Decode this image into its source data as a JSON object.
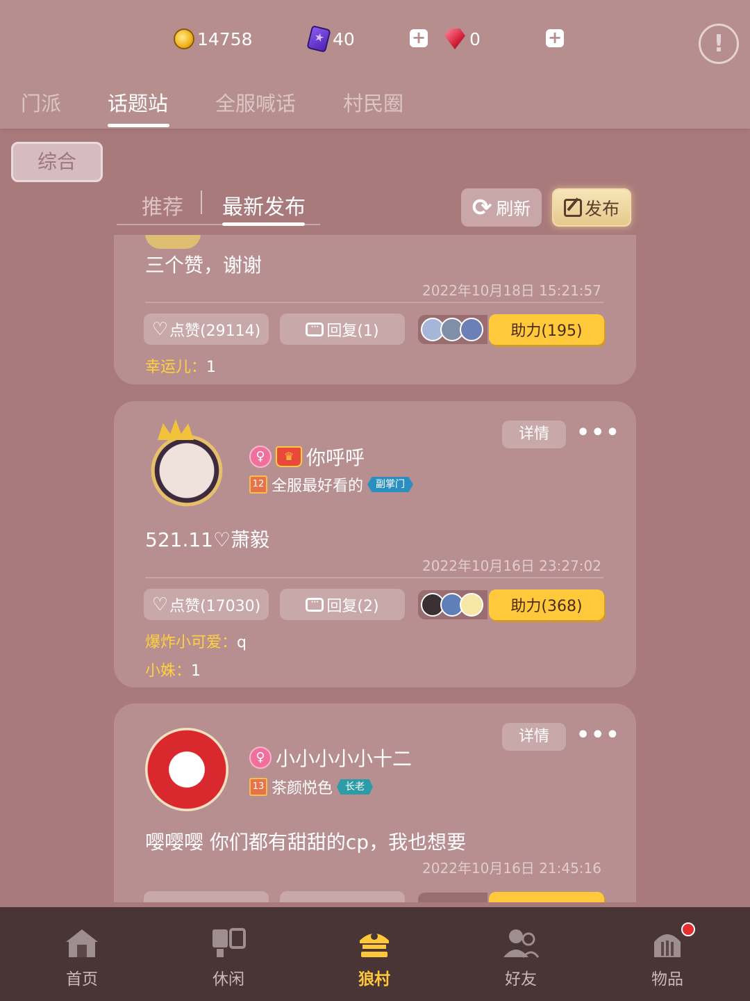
{
  "currency": {
    "coins": "14758",
    "cards": "40",
    "gems": "0"
  },
  "tabs": [
    "门派",
    "话题站",
    "全服喊话",
    "村民圈"
  ],
  "category": "综合",
  "subtabs": [
    "推荐",
    "最新发布"
  ],
  "actions": {
    "refresh": "刷新",
    "publish": "发布"
  },
  "posts": [
    {
      "content": "三个赞，谢谢",
      "time": "2022年10月18日 15:21:57",
      "like": "点赞(29114)",
      "reply": "回复(1)",
      "assist": "助力(195)",
      "comments": [
        {
          "user": "幸运儿：",
          "text": "1"
        }
      ]
    },
    {
      "detail": "详情",
      "more": "•••",
      "username": "你呼呼",
      "level": "12",
      "sect": "全服最好看的",
      "role": "副掌门",
      "content": "521.11♡萧毅",
      "time": "2022年10月16日 23:27:02",
      "like": "点赞(17030)",
      "reply": "回复(2)",
      "assist": "助力(368)",
      "comments": [
        {
          "user": "爆炸小可爱：",
          "text": "q"
        },
        {
          "user": "小姝：",
          "text": "1"
        }
      ]
    },
    {
      "detail": "详情",
      "more": "•••",
      "username": "小小小小小十二",
      "level": "13",
      "sect": "茶颜悦色",
      "role": "长老",
      "content": "嘤嘤嘤 你们都有甜甜的cp，我也想要",
      "time": "2022年10月16日 21:45:16"
    }
  ],
  "bottom_nav": [
    "首页",
    "休闲",
    "狼村",
    "好友",
    "物品"
  ],
  "colors": {
    "background": "#a97a7b",
    "card": "#b88f90",
    "accent": "#ffc93b",
    "nav_bg": "#4a3536"
  }
}
